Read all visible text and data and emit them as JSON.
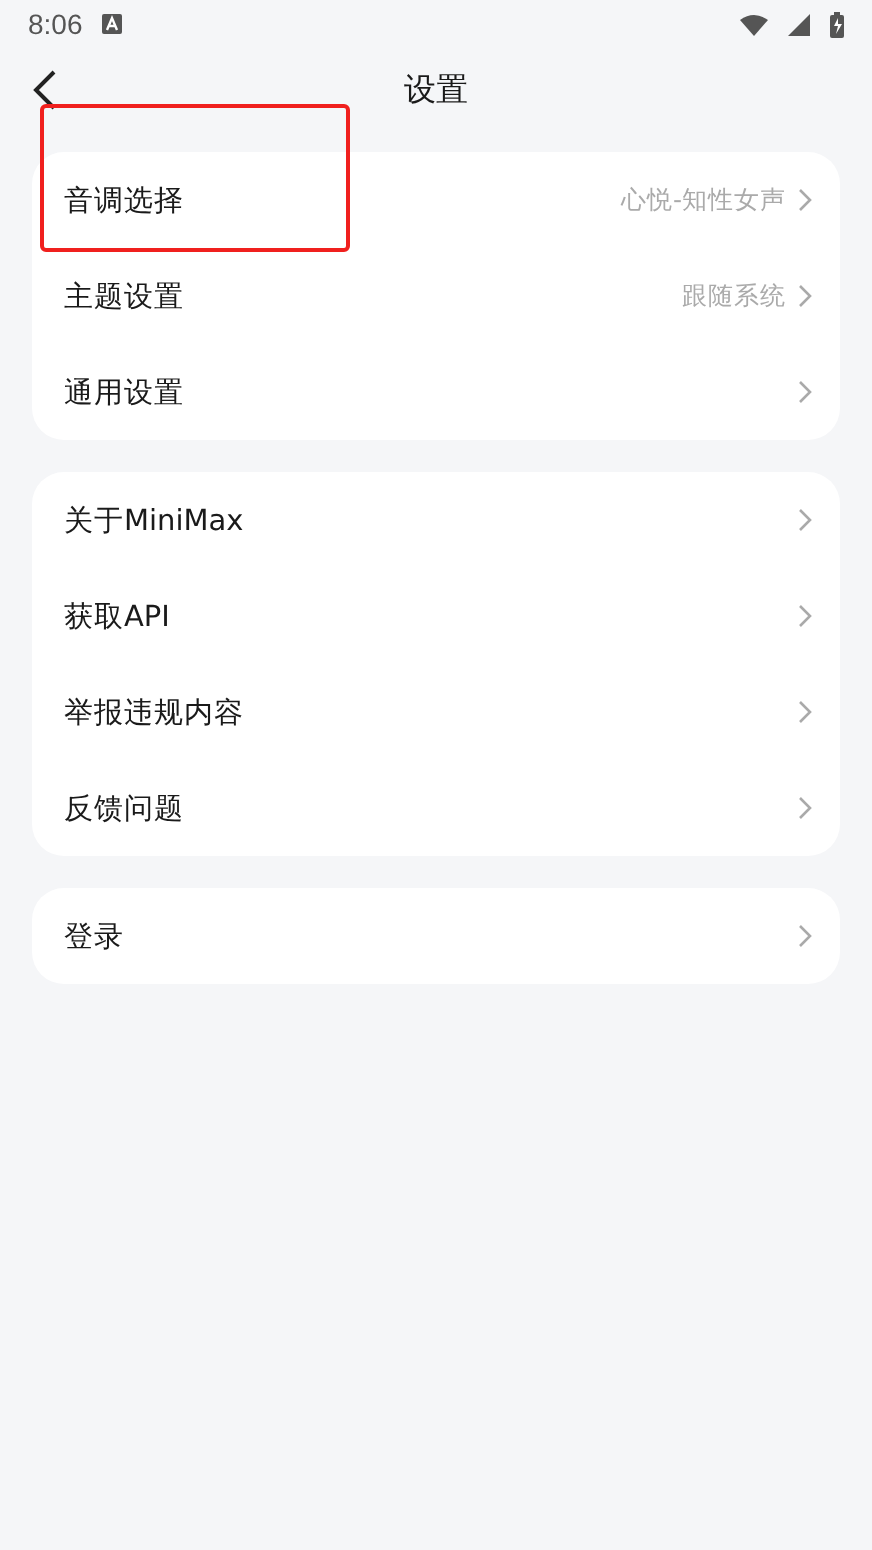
{
  "status_bar": {
    "time": "8:06"
  },
  "header": {
    "title": "设置"
  },
  "groups": [
    {
      "items": [
        {
          "label": "音调选择",
          "value": "心悦-知性女声",
          "highlighted": true
        },
        {
          "label": "主题设置",
          "value": "跟随系统"
        },
        {
          "label": "通用设置"
        }
      ]
    },
    {
      "items": [
        {
          "label": "关于MiniMax"
        },
        {
          "label": "获取API"
        },
        {
          "label": "举报违规内容"
        },
        {
          "label": "反馈问题"
        }
      ]
    },
    {
      "items": [
        {
          "label": "登录"
        }
      ]
    }
  ]
}
